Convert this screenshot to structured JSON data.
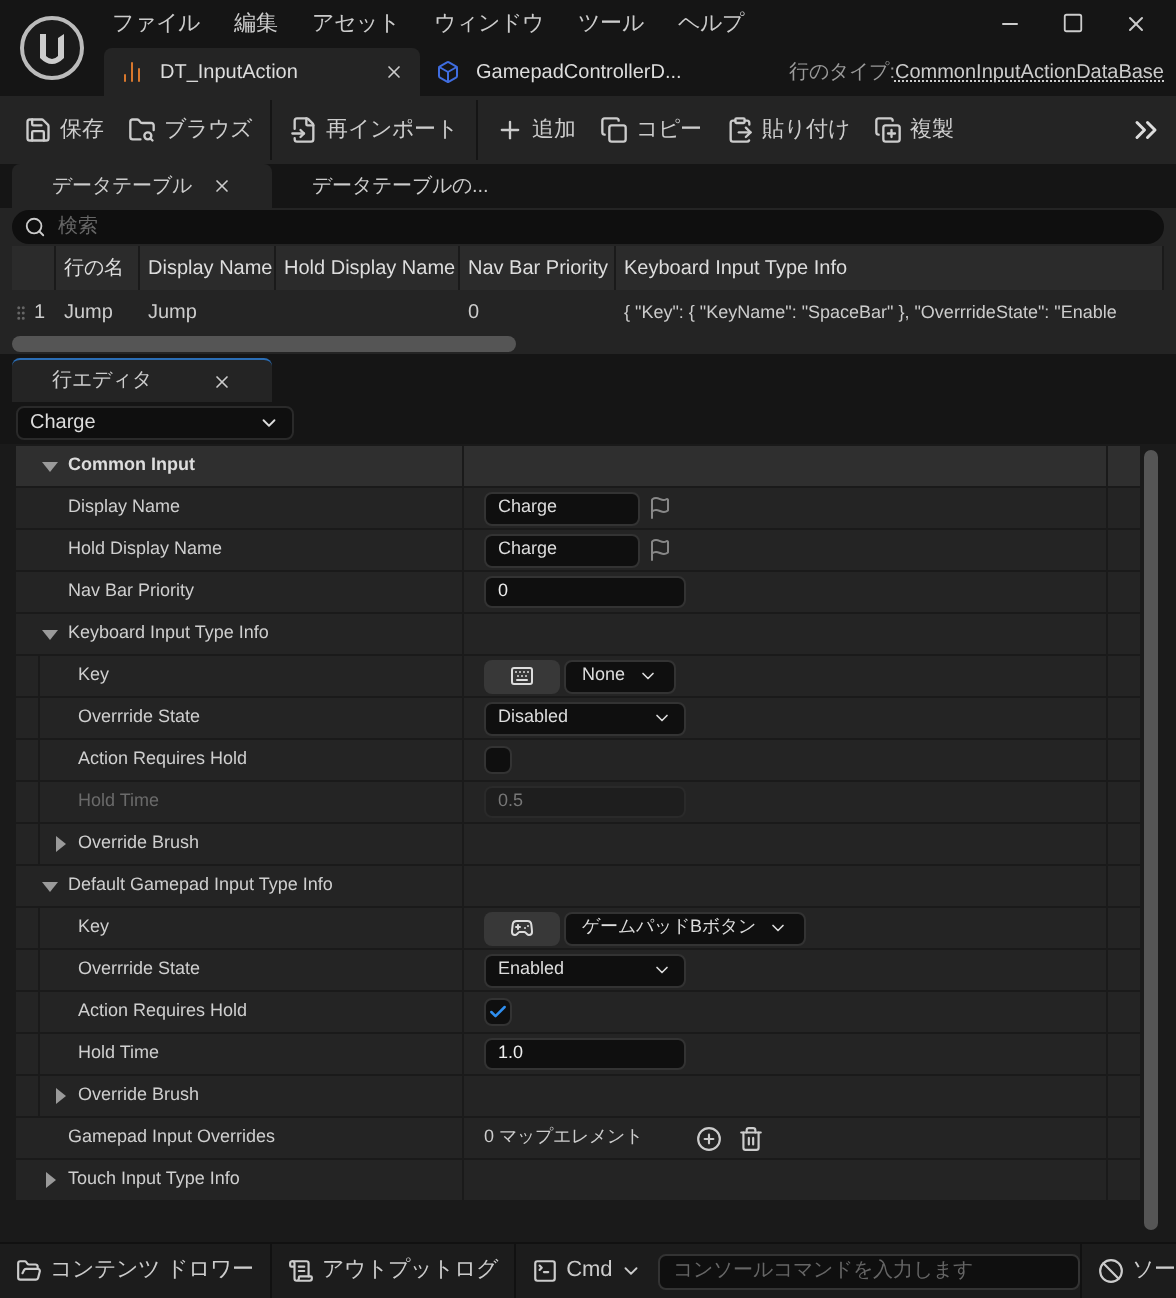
{
  "title_bar": {
    "menu": [
      "ファイル",
      "編集",
      "アセット",
      "ウィンドウ",
      "ツール",
      "ヘルプ"
    ],
    "tabs": [
      {
        "label": "DT_InputAction",
        "selected": true,
        "kind": "datatable"
      },
      {
        "label": "GamepadControllerD...",
        "selected": false,
        "kind": "blueprint"
      }
    ],
    "row_type_label": "行のタイプ:",
    "row_type_value": "CommonInputActionDataBase"
  },
  "toolbar": [
    {
      "label": "保存",
      "kind": "save"
    },
    {
      "label": "ブラウズ",
      "kind": "browse"
    },
    {
      "label": "再インポート",
      "kind": "reimport"
    },
    {
      "label": "追加",
      "kind": "add"
    },
    {
      "label": "コピー",
      "kind": "copy"
    },
    {
      "label": "貼り付け",
      "kind": "paste"
    },
    {
      "label": "複製",
      "kind": "duplicate"
    }
  ],
  "table_panel": {
    "tabs": [
      {
        "label": "データテーブル",
        "selected": true
      },
      {
        "label": "データテーブルの...",
        "selected": false
      }
    ],
    "search_placeholder": "検索",
    "columns": [
      "行の名",
      "Display Name",
      "Hold Display Name",
      "Nav Bar Priority",
      "Keyboard Input Type Info"
    ],
    "rows": [
      {
        "index": "1",
        "cells": [
          "Jump",
          "Jump",
          "",
          "0",
          "{ \"Key\": { \"KeyName\": \"SpaceBar\" }, \"OverrrideState\": \"Enable"
        ]
      }
    ]
  },
  "row_editor": {
    "tab": "行エディタ",
    "row_select": "Charge",
    "properties": [
      {
        "kind": "category",
        "label": "Common Input",
        "expanded": true,
        "children": [
          {
            "kind": "text",
            "label": "Display Name",
            "value": "Charge"
          },
          {
            "kind": "text",
            "label": "Hold Display Name",
            "value": "Charge"
          },
          {
            "kind": "number",
            "label": "Nav Bar Priority",
            "value": "0",
            "disabled": false
          },
          {
            "kind": "category",
            "label": "Keyboard Input Type Info",
            "expanded": true,
            "children": [
              {
                "kind": "keyboard_key",
                "label": "Key",
                "value": "None"
              },
              {
                "kind": "dropdown",
                "label": "Overrride State",
                "value": "Disabled"
              },
              {
                "kind": "checkbox",
                "label": "Action Requires Hold",
                "checked": false
              },
              {
                "kind": "number",
                "label": "Hold Time",
                "value": "0.5",
                "disabled": true
              },
              {
                "kind": "category",
                "label": "Override Brush",
                "expanded": false
              }
            ]
          },
          {
            "kind": "category",
            "label": "Default Gamepad Input Type Info",
            "expanded": true,
            "children": [
              {
                "kind": "gamepad_key",
                "label": "Key",
                "value": "ゲームパッドBボタン"
              },
              {
                "kind": "dropdown",
                "label": "Overrride State",
                "value": "Enabled"
              },
              {
                "kind": "checkbox",
                "label": "Action Requires Hold",
                "checked": true
              },
              {
                "kind": "number",
                "label": "Hold Time",
                "value": "1.0",
                "disabled": false
              },
              {
                "kind": "category",
                "label": "Override Brush",
                "expanded": false
              }
            ]
          },
          {
            "kind": "map",
            "label": "Gamepad Input Overrides",
            "value": "0 マップエレメント"
          },
          {
            "kind": "category",
            "label": "Touch Input Type Info",
            "expanded": false
          }
        ]
      }
    ]
  },
  "bottom_bar": {
    "content_drawer": "コンテンツ ドロワー",
    "output_log": "アウトプットログ",
    "cmd": "Cmd",
    "console_placeholder": "コンソールコマンドを入力します",
    "source_control": "ソー"
  }
}
